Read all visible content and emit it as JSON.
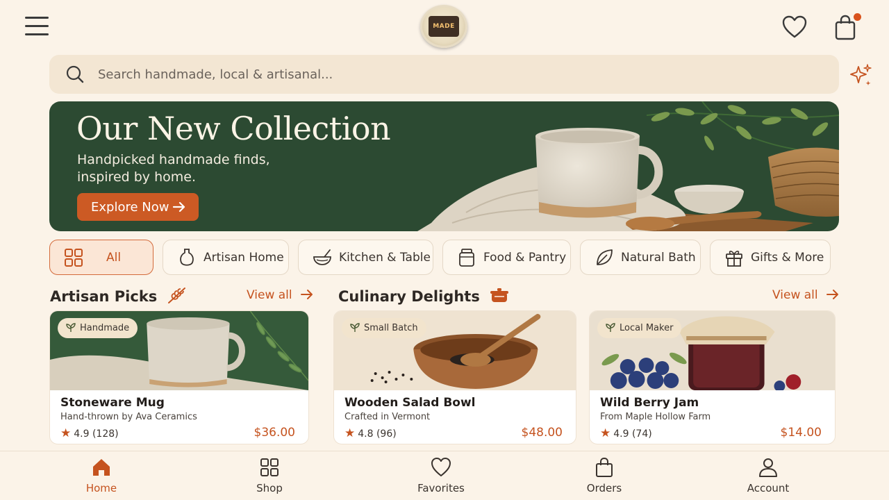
{
  "header": {
    "logo_text": "MADE",
    "cart_has_notification": true,
    "accent": "#c5531f"
  },
  "search": {
    "placeholder": "Search handmade, local & artisanal..."
  },
  "hero": {
    "title": "Our New Collection",
    "subtitle": "Handpicked handmade finds, inspired by home.",
    "cta": "Explore Now",
    "background": "#2c4a32"
  },
  "categories": [
    {
      "label": "All",
      "icon": "grid-icon",
      "active": true
    },
    {
      "label": "Artisan Home",
      "icon": "vase-icon",
      "active": false
    },
    {
      "label": "Kitchen & Table",
      "icon": "bowl-icon",
      "active": false
    },
    {
      "label": "Food & Pantry",
      "icon": "jar-icon",
      "active": false
    },
    {
      "label": "Natural Bath",
      "icon": "leaf-icon",
      "active": false
    },
    {
      "label": "Gifts & More",
      "icon": "gift-icon",
      "active": false
    }
  ],
  "sections": {
    "artisan": {
      "title": "Artisan Picks",
      "view_all": "View all",
      "icon": "wheat-icon"
    },
    "culinary": {
      "title": "Culinary Delights",
      "view_all": "View all",
      "icon": "pot-icon"
    }
  },
  "products": [
    {
      "badge": "Handmade",
      "name": "Stoneware Mug",
      "maker": "Hand-thrown by Ava Ceramics",
      "rating": "4.9",
      "reviews": "(128)",
      "price": "$36.00"
    },
    {
      "badge": "Small Batch",
      "name": "Wooden Salad Bowl",
      "maker": "Crafted in Vermont",
      "rating": "4.8",
      "reviews": "(96)",
      "price": "$48.00"
    },
    {
      "badge": "Local Maker",
      "name": "Wild Berry Jam",
      "maker": "From Maple Hollow Farm",
      "rating": "4.9",
      "reviews": "(74)",
      "price": "$14.00"
    }
  ],
  "nav": [
    {
      "label": "Home",
      "icon": "home-icon",
      "active": true
    },
    {
      "label": "Shop",
      "icon": "grid-icon",
      "active": false
    },
    {
      "label": "Favorites",
      "icon": "heart-icon",
      "active": false
    },
    {
      "label": "Orders",
      "icon": "bag-icon",
      "active": false
    },
    {
      "label": "Account",
      "icon": "user-icon",
      "active": false
    }
  ]
}
